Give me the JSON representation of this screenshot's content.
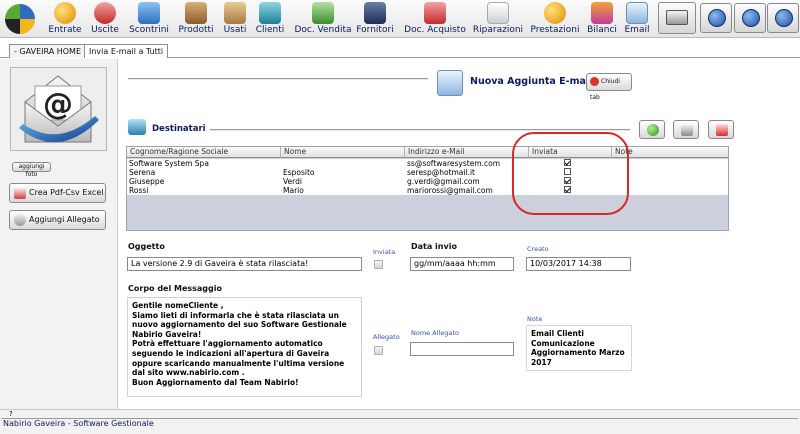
{
  "toolbar": {
    "items": [
      {
        "label": "Entrate",
        "icon": "coin-icon"
      },
      {
        "label": "Uscite",
        "icon": "no-entry-icon"
      },
      {
        "label": "Scontrini",
        "icon": "receipt-icon"
      },
      {
        "label": "Prodotti",
        "icon": "shelf-icon"
      },
      {
        "label": "Usati",
        "icon": "box-icon"
      },
      {
        "label": "Clienti",
        "icon": "book-icon"
      },
      {
        "label": "Doc. Vendita",
        "icon": "document-up-icon"
      },
      {
        "label": "Fornitori",
        "icon": "building-icon"
      },
      {
        "label": "Doc. Acquisto",
        "icon": "document-down-icon"
      },
      {
        "label": "Riparazioni",
        "icon": "repair-document-icon"
      },
      {
        "label": "Prestazioni",
        "icon": "services-icon"
      },
      {
        "label": "Bilanci",
        "icon": "balance-icon"
      },
      {
        "label": "Email",
        "icon": "email-icon"
      }
    ]
  },
  "tabs": [
    {
      "label": "- GAVEIRA HOME -"
    },
    {
      "label": "Invia E-mail a Tutti"
    }
  ],
  "left": {
    "add_photo_label": "aggiungi foto",
    "pdf_csv_label": "Crea Pdf-Csv Excel",
    "attach_label": "Aggiungi Allegato"
  },
  "header": {
    "title": "Nuova Aggiunta E-mail",
    "close_label": "Chiudi tab"
  },
  "recipients": {
    "title": "Destinatari",
    "columns": [
      "Cognome/Ragione Sociale",
      "Nome",
      "Indirizzo e-Mail",
      "Inviata",
      "Note"
    ],
    "rows": [
      {
        "cognome": "Software System Spa",
        "nome": "",
        "email": "ss@softwaresystem.com",
        "inviata": true,
        "note": ""
      },
      {
        "cognome": "Serena",
        "nome": "Esposito",
        "email": "seresp@hotmail.it",
        "inviata": false,
        "note": ""
      },
      {
        "cognome": "Giuseppe",
        "nome": "Verdi",
        "email": "g.verdi@gmail.com",
        "inviata": true,
        "note": ""
      },
      {
        "cognome": "Rossi",
        "nome": "Mario",
        "email": "mariorossi@gmail.com",
        "inviata": true,
        "note": ""
      }
    ]
  },
  "form": {
    "oggetto_label": "Oggetto",
    "oggetto_value": "La versione 2.9 di Gaveira è stata rilasciata!",
    "inviata_label": "Inviata",
    "data_invio_label": "Data invio",
    "data_invio_placeholder": "gg/mm/aaaa hh:mm",
    "creato_label": "Creato",
    "creato_value": "10/03/2017 14:38",
    "corpo_label": "Corpo del Messaggio",
    "corpo_lines": [
      "Gentile nomeCliente ,",
      "Siamo lieti di informarla che è stata rilasciata un",
      "nuovo aggiornamento del suo Software Gestionale",
      "Nabirio Gaveira!",
      "Potrà effettuare l'aggiornamento automatico",
      "seguendo le indicazioni all'apertura di Gaveira",
      "oppure scaricando manualmente l'ultima versione",
      "dal sito www.nabirio.com .",
      "Buon Aggiornamento dal Team Nabirio!"
    ],
    "allegato_label": "Allegato",
    "nome_allegato_label": "Nome Allegato",
    "nome_allegato_value": "",
    "note_label": "Note",
    "note_lines": [
      "Email Clienti",
      "Comunicazione",
      "Aggiornamento Marzo",
      "2017"
    ]
  },
  "status": {
    "text": "Nabirio Gaveira - Software Gestionale",
    "mark": "?"
  }
}
